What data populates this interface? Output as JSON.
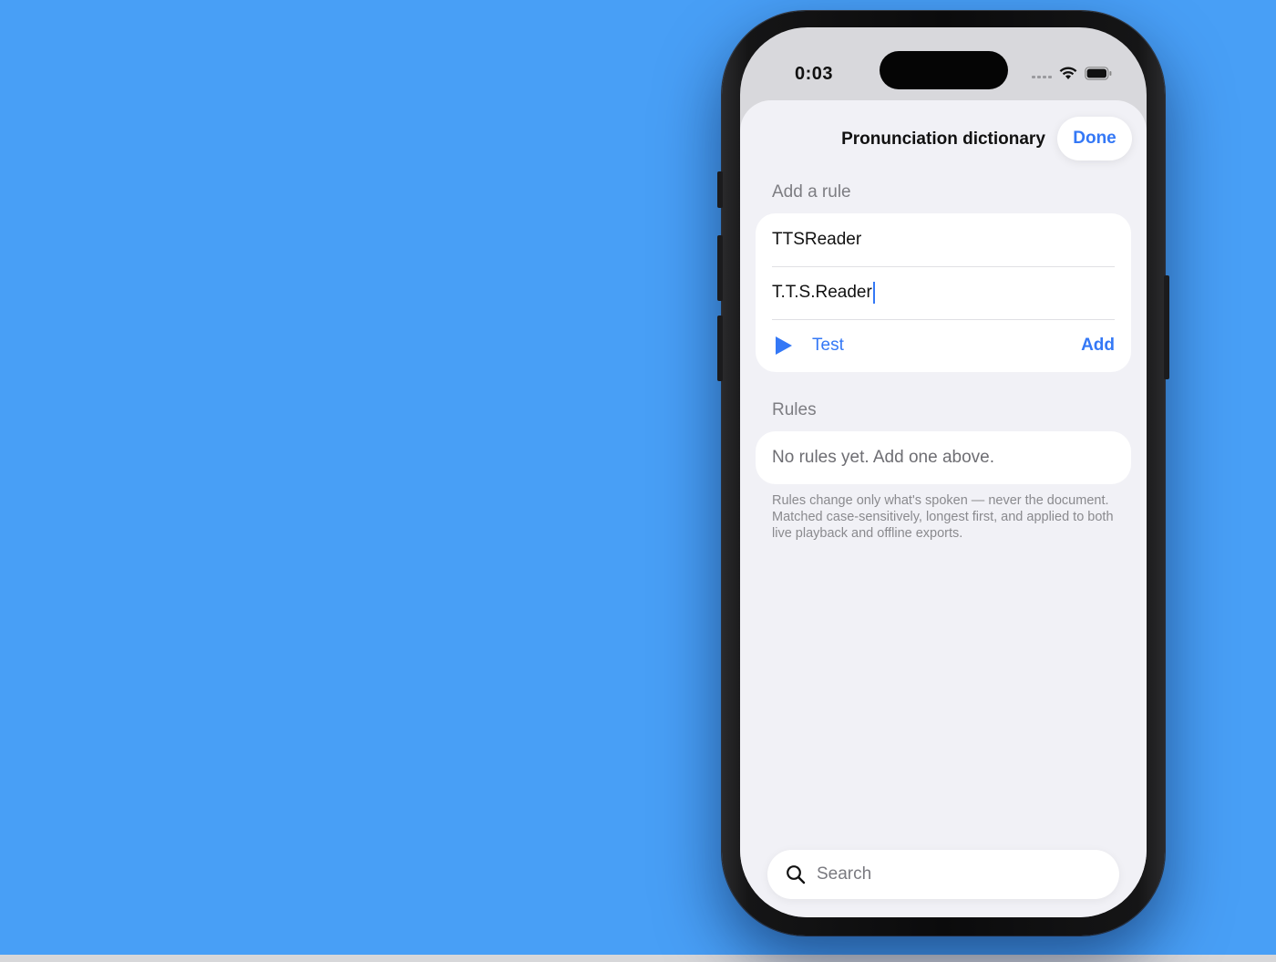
{
  "status_bar": {
    "time": "0:03"
  },
  "sheet": {
    "title": "Pronunciation dictionary",
    "done_label": "Done"
  },
  "add_rule": {
    "header": "Add a rule",
    "word_value": "TTSReader",
    "replacement_value": "T.T.S.Reader",
    "test_label": "Test",
    "add_label": "Add"
  },
  "rules": {
    "header": "Rules",
    "empty_text": "No rules yet. Add one above.",
    "footnote": "Rules change only what's spoken — never the document. Matched case-sensitively, longest first, and applied to both live playback and offline exports."
  },
  "search": {
    "placeholder": "Search"
  },
  "colors": {
    "background": "#489ff6",
    "accent": "#3478f6",
    "sheet": "#f1f1f6"
  }
}
